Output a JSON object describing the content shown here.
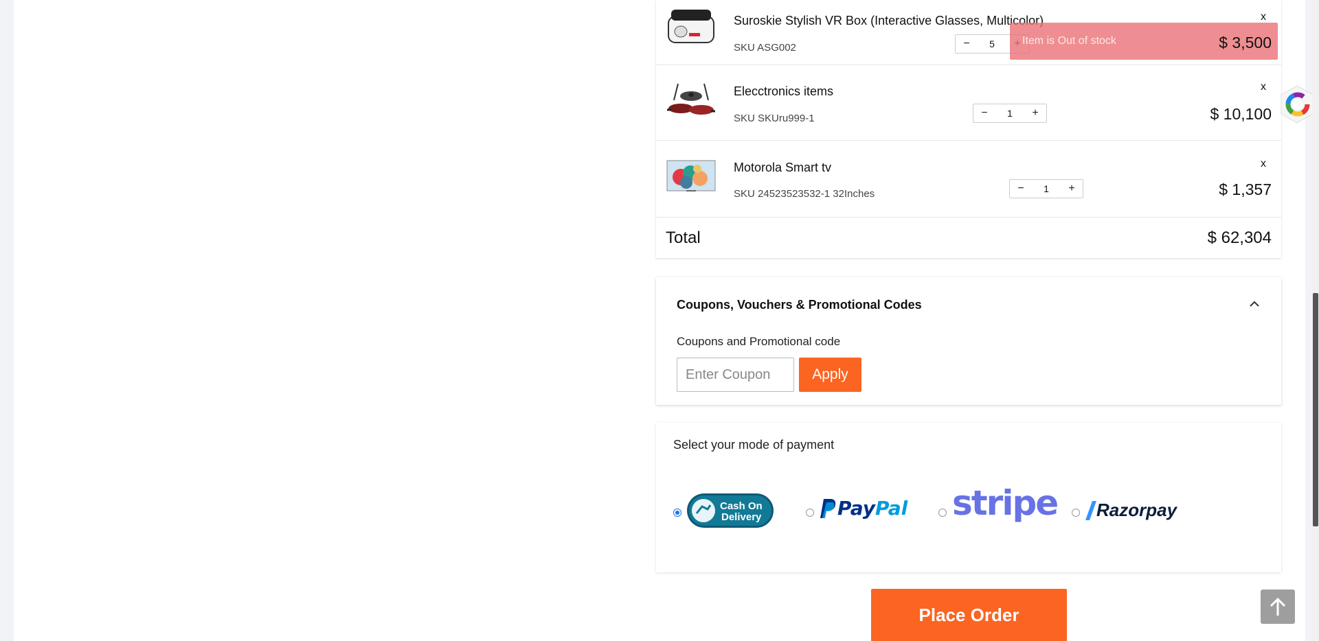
{
  "cart": {
    "items": [
      {
        "name": "Suroskie Stylish VR Box (Interactive Glasses, Multicolor)",
        "sku": "SKU ASG002",
        "qty": "5",
        "price": "$ 3,500",
        "remove_label": "x",
        "decrement_label": "−",
        "increment_label": "+"
      },
      {
        "name": "Elecctronics items",
        "sku": "SKU SKUru999-1",
        "qty": "1",
        "price": "$ 10,100",
        "remove_label": "x",
        "decrement_label": "−",
        "increment_label": "+"
      },
      {
        "name": "Motorola Smart tv",
        "sku": "SKU 24523523532-1 32Inches",
        "qty": "1",
        "price": "$ 1,357",
        "remove_label": "x",
        "decrement_label": "−",
        "increment_label": "+"
      }
    ],
    "total_label": "Total",
    "total_value": "$ 62,304"
  },
  "toast": {
    "message": "Item is Out of stock"
  },
  "coupons": {
    "title": "Coupons, Vouchers & Promotional Codes",
    "field_label": "Coupons and Promotional code",
    "placeholder": "Enter Coupon",
    "value": "",
    "apply_label": "Apply"
  },
  "payment": {
    "title": "Select your mode of payment",
    "options": [
      {
        "name": "Cash On Delivery",
        "line1": "Cash On",
        "line2": "Delivery",
        "selected": true
      },
      {
        "name": "PayPal",
        "label": "PayPal",
        "selected": false
      },
      {
        "name": "Stripe",
        "label": "stripe",
        "selected": false
      },
      {
        "name": "Razorpay",
        "label": "Razorpay",
        "selected": false
      }
    ]
  },
  "place_order_label": "Place Order",
  "colors": {
    "accent": "#fb6421",
    "toast": "#eb6e73",
    "radio_selected": "#1a73e8",
    "stripe": "#6772e5",
    "paypal_dark": "#003087",
    "paypal_light": "#009cde"
  }
}
